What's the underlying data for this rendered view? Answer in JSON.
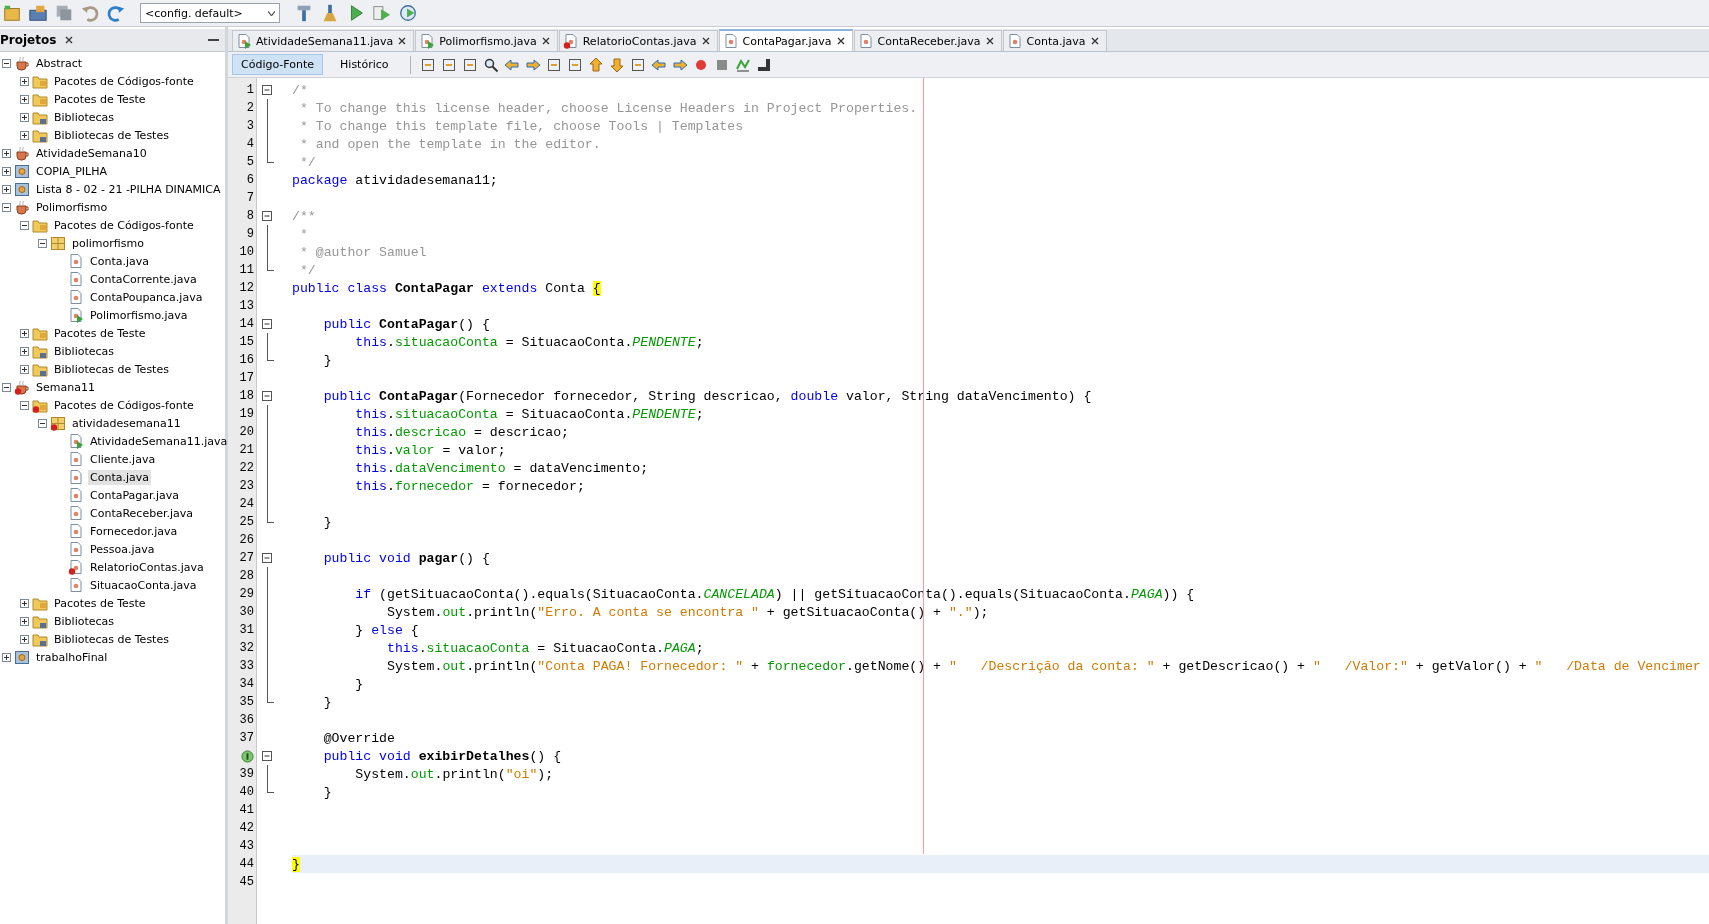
{
  "toolbar": {
    "config": "<config. default>"
  },
  "projects_panel": {
    "title": "Projetos",
    "items": [
      {
        "label": "Abstract",
        "kind": "project",
        "expanded": true,
        "selected": false,
        "children": [
          {
            "label": "Pacotes de Códigos-fonte",
            "kind": "folder",
            "expanded": false,
            "selected": false
          },
          {
            "label": "Pacotes de Teste",
            "kind": "folder",
            "expanded": false,
            "selected": false
          },
          {
            "label": "Bibliotecas",
            "kind": "library",
            "expanded": false,
            "selected": false
          },
          {
            "label": "Bibliotecas de Testes",
            "kind": "library",
            "expanded": false,
            "selected": false
          }
        ]
      },
      {
        "label": "AtividadeSemana10",
        "kind": "project",
        "expanded": false,
        "selected": false
      },
      {
        "label": "COPIA_PILHA",
        "kind": "library-project",
        "expanded": false,
        "selected": false
      },
      {
        "label": "Lista 8 - 02 - 21 -PILHA DINAMICA",
        "kind": "library-project",
        "expanded": false,
        "selected": false
      },
      {
        "label": "Polimorfismo",
        "kind": "project",
        "expanded": true,
        "selected": false,
        "children": [
          {
            "label": "Pacotes de Códigos-fonte",
            "kind": "folder",
            "expanded": true,
            "selected": false,
            "children": [
              {
                "label": "polimorfismo",
                "kind": "package",
                "expanded": true,
                "selected": false,
                "children": [
                  {
                    "label": "Conta.java",
                    "kind": "file",
                    "selected": false
                  },
                  {
                    "label": "ContaCorrente.java",
                    "kind": "file",
                    "selected": false
                  },
                  {
                    "label": "ContaPoupanca.java",
                    "kind": "file",
                    "selected": false
                  },
                  {
                    "label": "Polimorfismo.java",
                    "kind": "main-file",
                    "selected": false
                  }
                ]
              }
            ]
          },
          {
            "label": "Pacotes de Teste",
            "kind": "folder",
            "expanded": false,
            "selected": false
          },
          {
            "label": "Bibliotecas",
            "kind": "library",
            "expanded": false,
            "selected": false
          },
          {
            "label": "Bibliotecas de Testes",
            "kind": "library",
            "expanded": false,
            "selected": false
          }
        ]
      },
      {
        "label": "Semana11",
        "kind": "project-error",
        "expanded": true,
        "selected": false,
        "children": [
          {
            "label": "Pacotes de Códigos-fonte",
            "kind": "folder-error",
            "expanded": true,
            "selected": false,
            "children": [
              {
                "label": "atividadesemana11",
                "kind": "package-error",
                "expanded": true,
                "selected": false,
                "children": [
                  {
                    "label": "AtividadeSemana11.java",
                    "kind": "main-file",
                    "selected": false
                  },
                  {
                    "label": "Cliente.java",
                    "kind": "file",
                    "selected": false
                  },
                  {
                    "label": "Conta.java",
                    "kind": "file",
                    "selected": true
                  },
                  {
                    "label": "ContaPagar.java",
                    "kind": "file",
                    "selected": false
                  },
                  {
                    "label": "ContaReceber.java",
                    "kind": "file",
                    "selected": false
                  },
                  {
                    "label": "Fornecedor.java",
                    "kind": "file",
                    "selected": false
                  },
                  {
                    "label": "Pessoa.java",
                    "kind": "file",
                    "selected": false
                  },
                  {
                    "label": "RelatorioContas.java",
                    "kind": "error-file",
                    "selected": false
                  },
                  {
                    "label": "SituacaoConta.java",
                    "kind": "file",
                    "selected": false
                  }
                ]
              }
            ]
          },
          {
            "label": "Pacotes de Teste",
            "kind": "folder",
            "expanded": false,
            "selected": false
          },
          {
            "label": "Bibliotecas",
            "kind": "library",
            "expanded": false,
            "selected": false
          },
          {
            "label": "Bibliotecas de Testes",
            "kind": "library",
            "expanded": false,
            "selected": false
          }
        ]
      },
      {
        "label": "trabalhoFinal",
        "kind": "library-project",
        "expanded": false,
        "selected": false
      }
    ]
  },
  "editor_tabs": [
    {
      "label": "AtividadeSemana11.java",
      "kind": "main-file",
      "selected": false
    },
    {
      "label": "Polimorfismo.java",
      "kind": "main-file",
      "selected": false
    },
    {
      "label": "RelatorioContas.java",
      "kind": "error-file",
      "selected": false
    },
    {
      "label": "ContaPagar.java",
      "kind": "file",
      "selected": true
    },
    {
      "label": "ContaReceber.java",
      "kind": "file",
      "selected": false
    },
    {
      "label": "Conta.java",
      "kind": "file",
      "selected": false
    }
  ],
  "editor_views": [
    {
      "label": "Código-Fonte",
      "selected": true
    },
    {
      "label": "Histórico",
      "selected": false
    }
  ],
  "code_lines": [
    {
      "number": "1",
      "kind": "fold-start",
      "tokens": [
        {
          "kind": "comment",
          "text": "/*"
        }
      ]
    },
    {
      "number": "2",
      "kind": "plain",
      "tokens": [
        {
          "kind": "comment",
          "text": " * To change this license header, choose License Headers in Project Properties."
        }
      ]
    },
    {
      "number": "3",
      "kind": "plain",
      "tokens": [
        {
          "kind": "comment",
          "text": " * To change this template file, choose Tools | Templates"
        }
      ]
    },
    {
      "number": "4",
      "kind": "plain",
      "tokens": [
        {
          "kind": "comment",
          "text": " * and open the template in the editor."
        }
      ]
    },
    {
      "number": "5",
      "kind": "fold-end",
      "tokens": [
        {
          "kind": "comment",
          "text": " */"
        }
      ]
    },
    {
      "number": "6",
      "kind": "plain",
      "tokens": [
        {
          "kind": "keyword",
          "text": "package"
        },
        {
          "kind": "plain",
          "text": " atividadesemana11;"
        }
      ]
    },
    {
      "number": "7",
      "kind": "plain"
    },
    {
      "number": "8",
      "kind": "fold-start",
      "tokens": [
        {
          "kind": "comment",
          "text": "/**"
        }
      ]
    },
    {
      "number": "9",
      "kind": "plain",
      "tokens": [
        {
          "kind": "comment",
          "text": " *"
        }
      ]
    },
    {
      "number": "10",
      "kind": "plain",
      "tokens": [
        {
          "kind": "comment",
          "text": " * @author Samuel"
        }
      ]
    },
    {
      "number": "11",
      "kind": "fold-end",
      "tokens": [
        {
          "kind": "comment",
          "text": " */"
        }
      ]
    },
    {
      "number": "12",
      "kind": "plain",
      "tokens": [
        {
          "kind": "keyword",
          "text": "public class "
        },
        {
          "kind": "declaration",
          "text": "ContaPagar"
        },
        {
          "kind": "keyword",
          "text": " extends"
        },
        {
          "kind": "plain",
          "text": " Conta "
        },
        {
          "kind": "brace-match",
          "text": "{"
        }
      ]
    },
    {
      "number": "13",
      "kind": "plain"
    },
    {
      "number": "14",
      "kind": "fold-start",
      "tokens": [
        {
          "kind": "keyword",
          "text": "    public "
        },
        {
          "kind": "declaration",
          "text": "ContaPagar"
        },
        {
          "kind": "plain",
          "text": "() {"
        }
      ]
    },
    {
      "number": "15",
      "kind": "plain",
      "tokens": [
        {
          "kind": "keyword",
          "text": "        this"
        },
        {
          "kind": "plain",
          "text": "."
        },
        {
          "kind": "field",
          "text": "situacaoConta"
        },
        {
          "kind": "plain",
          "text": " = SituacaoConta."
        },
        {
          "kind": "constant",
          "text": "PENDENTE"
        },
        {
          "kind": "plain",
          "text": ";"
        }
      ]
    },
    {
      "number": "16",
      "kind": "fold-end",
      "tokens": [
        {
          "kind": "plain",
          "text": "    }"
        }
      ]
    },
    {
      "number": "17",
      "kind": "plain"
    },
    {
      "number": "18",
      "kind": "fold-start",
      "tokens": [
        {
          "kind": "keyword",
          "text": "    public "
        },
        {
          "kind": "declaration",
          "text": "ContaPagar"
        },
        {
          "kind": "plain",
          "text": "(Fornecedor fornecedor, String descricao, "
        },
        {
          "kind": "keyword",
          "text": "double"
        },
        {
          "kind": "plain",
          "text": " valor, String dataVencimento) {"
        }
      ]
    },
    {
      "number": "19",
      "kind": "plain",
      "tokens": [
        {
          "kind": "keyword",
          "text": "        this"
        },
        {
          "kind": "plain",
          "text": "."
        },
        {
          "kind": "field",
          "text": "situacaoConta"
        },
        {
          "kind": "plain",
          "text": " = SituacaoConta."
        },
        {
          "kind": "constant",
          "text": "PENDENTE"
        },
        {
          "kind": "plain",
          "text": ";"
        }
      ]
    },
    {
      "number": "20",
      "kind": "plain",
      "tokens": [
        {
          "kind": "keyword",
          "text": "        this"
        },
        {
          "kind": "plain",
          "text": "."
        },
        {
          "kind": "field",
          "text": "descricao"
        },
        {
          "kind": "plain",
          "text": " = descricao;"
        }
      ]
    },
    {
      "number": "21",
      "kind": "plain",
      "tokens": [
        {
          "kind": "keyword",
          "text": "        this"
        },
        {
          "kind": "plain",
          "text": "."
        },
        {
          "kind": "field",
          "text": "valor"
        },
        {
          "kind": "plain",
          "text": " = valor;"
        }
      ]
    },
    {
      "number": "22",
      "kind": "plain",
      "tokens": [
        {
          "kind": "keyword",
          "text": "        this"
        },
        {
          "kind": "plain",
          "text": "."
        },
        {
          "kind": "field",
          "text": "dataVencimento"
        },
        {
          "kind": "plain",
          "text": " = dataVencimento;"
        }
      ]
    },
    {
      "number": "23",
      "kind": "plain",
      "tokens": [
        {
          "kind": "keyword",
          "text": "        this"
        },
        {
          "kind": "plain",
          "text": "."
        },
        {
          "kind": "field",
          "text": "fornecedor"
        },
        {
          "kind": "plain",
          "text": " = fornecedor;"
        }
      ]
    },
    {
      "number": "24",
      "kind": "plain"
    },
    {
      "number": "25",
      "kind": "fold-end",
      "tokens": [
        {
          "kind": "plain",
          "text": "    }"
        }
      ]
    },
    {
      "number": "26",
      "kind": "plain"
    },
    {
      "number": "27",
      "kind": "fold-start",
      "tokens": [
        {
          "kind": "keyword",
          "text": "    public void "
        },
        {
          "kind": "declaration",
          "text": "pagar"
        },
        {
          "kind": "plain",
          "text": "() {"
        }
      ]
    },
    {
      "number": "28",
      "kind": "plain"
    },
    {
      "number": "29",
      "kind": "plain",
      "tokens": [
        {
          "kind": "keyword",
          "text": "        if"
        },
        {
          "kind": "plain",
          "text": " (getSituacaoConta().equals(SituacaoConta."
        },
        {
          "kind": "constant",
          "text": "CANCELADA"
        },
        {
          "kind": "plain",
          "text": ") || getSituacaoConta().equals(SituacaoConta."
        },
        {
          "kind": "constant",
          "text": "PAGA"
        },
        {
          "kind": "plain",
          "text": ")) {"
        }
      ]
    },
    {
      "number": "30",
      "kind": "plain",
      "tokens": [
        {
          "kind": "plain",
          "text": "            System."
        },
        {
          "kind": "field",
          "text": "out"
        },
        {
          "kind": "plain",
          "text": ".println("
        },
        {
          "kind": "string",
          "text": "\"Erro. A conta se encontra \""
        },
        {
          "kind": "plain",
          "text": " + getSituacaoConta() + "
        },
        {
          "kind": "string",
          "text": "\".\""
        },
        {
          "kind": "plain",
          "text": ");"
        }
      ]
    },
    {
      "number": "31",
      "kind": "plain",
      "tokens": [
        {
          "kind": "plain",
          "text": "        } "
        },
        {
          "kind": "keyword",
          "text": "else"
        },
        {
          "kind": "plain",
          "text": " {"
        }
      ]
    },
    {
      "number": "32",
      "kind": "plain",
      "tokens": [
        {
          "kind": "keyword",
          "text": "            this"
        },
        {
          "kind": "plain",
          "text": "."
        },
        {
          "kind": "field",
          "text": "situacaoConta"
        },
        {
          "kind": "plain",
          "text": " = SituacaoConta."
        },
        {
          "kind": "constant",
          "text": "PAGA"
        },
        {
          "kind": "plain",
          "text": ";"
        }
      ]
    },
    {
      "number": "33",
      "kind": "plain",
      "tokens": [
        {
          "kind": "plain",
          "text": "            System."
        },
        {
          "kind": "field",
          "text": "out"
        },
        {
          "kind": "plain",
          "text": ".println("
        },
        {
          "kind": "string",
          "text": "\"Conta PAGA! Fornecedor: \""
        },
        {
          "kind": "plain",
          "text": " + "
        },
        {
          "kind": "field",
          "text": "fornecedor"
        },
        {
          "kind": "plain",
          "text": ".getNome() + "
        },
        {
          "kind": "string",
          "text": "\"   /Descrição da conta: \""
        },
        {
          "kind": "plain",
          "text": " + getDescricao() + "
        },
        {
          "kind": "string",
          "text": "\"   /Valor:\""
        },
        {
          "kind": "plain",
          "text": " + getValor() + "
        },
        {
          "kind": "string",
          "text": "\"   /Data de Vencimer"
        }
      ]
    },
    {
      "number": "34",
      "kind": "plain",
      "tokens": [
        {
          "kind": "plain",
          "text": "        }"
        }
      ]
    },
    {
      "number": "35",
      "kind": "fold-end",
      "tokens": [
        {
          "kind": "plain",
          "text": "    }"
        }
      ]
    },
    {
      "number": "36",
      "kind": "plain"
    },
    {
      "number": "37",
      "kind": "plain",
      "tokens": [
        {
          "kind": "plain",
          "text": "    @Override"
        }
      ]
    },
    {
      "kind": "marker-fold-start",
      "tokens": [
        {
          "kind": "keyword",
          "text": "    public void "
        },
        {
          "kind": "declaration",
          "text": "exibirDetalhes"
        },
        {
          "kind": "plain",
          "text": "() {"
        }
      ]
    },
    {
      "number": "39",
      "kind": "plain",
      "tokens": [
        {
          "kind": "plain",
          "text": "        System."
        },
        {
          "kind": "field",
          "text": "out"
        },
        {
          "kind": "plain",
          "text": ".println("
        },
        {
          "kind": "string",
          "text": "\"oi\""
        },
        {
          "kind": "plain",
          "text": ");"
        }
      ]
    },
    {
      "number": "40",
      "kind": "fold-end",
      "tokens": [
        {
          "kind": "plain",
          "text": "    }"
        }
      ]
    },
    {
      "number": "41",
      "kind": "plain"
    },
    {
      "number": "42",
      "kind": "plain"
    },
    {
      "number": "43",
      "kind": "plain"
    },
    {
      "number": "44",
      "kind": "plain",
      "current": true,
      "tokens": [
        {
          "kind": "brace-match",
          "text": "}"
        }
      ]
    },
    {
      "number": "45",
      "kind": "plain"
    }
  ]
}
